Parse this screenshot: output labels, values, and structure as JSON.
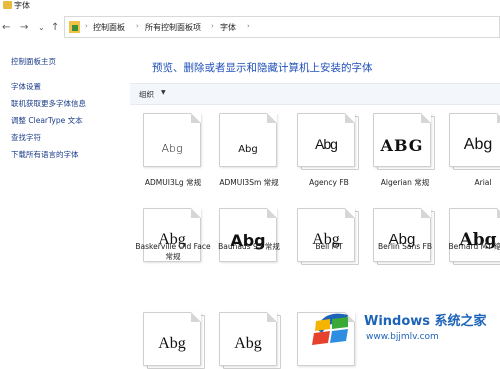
{
  "window": {
    "title": "字体"
  },
  "nav": {
    "back": "←",
    "forward": "→",
    "dropdown": "⌄",
    "up": "↑"
  },
  "breadcrumb": [
    "控制面板",
    "所有控制面板项",
    "字体"
  ],
  "sidebar": {
    "home": "控制面板主页",
    "links": [
      "字体设置",
      "联机获取更多字体信息",
      "调整 ClearType 文本",
      "查找字符",
      "下载所有语言的字体"
    ]
  },
  "main": {
    "heading": "预览、删除或者显示和隐藏计算机上安装的字体",
    "organize": "组织",
    "caret": "▼"
  },
  "fonts": [
    {
      "sample": "Abg",
      "label": "ADMUI3Lg 常规"
    },
    {
      "sample": "Abg",
      "label": "ADMUI3Sm 常规"
    },
    {
      "sample": "Abg",
      "label": "Agency FB"
    },
    {
      "sample": "ABG",
      "label": "Algerian 常规"
    },
    {
      "sample": "Abg",
      "label": "Arial"
    },
    {
      "sample": "Abg",
      "label": "Baskerville Old Face 常规"
    },
    {
      "sample": "Abg",
      "label": "Bauhaus 93 常规"
    },
    {
      "sample": "Abg",
      "label": "Bell MT"
    },
    {
      "sample": "Abg",
      "label": "Berlin Sans FB"
    },
    {
      "sample": "Abg",
      "label": "Bernard MT 缩"
    },
    {
      "sample": "Abg",
      "label": ""
    },
    {
      "sample": "Abg",
      "label": ""
    },
    {
      "sample": "",
      "label": ""
    }
  ],
  "watermark": {
    "line1": "Windows 系统之家",
    "line2": "www.bjjmlv.com"
  },
  "colors": {
    "link": "#1a3b8a",
    "heading": "#1f4fb8",
    "toolbar": "#f3f6fa"
  }
}
